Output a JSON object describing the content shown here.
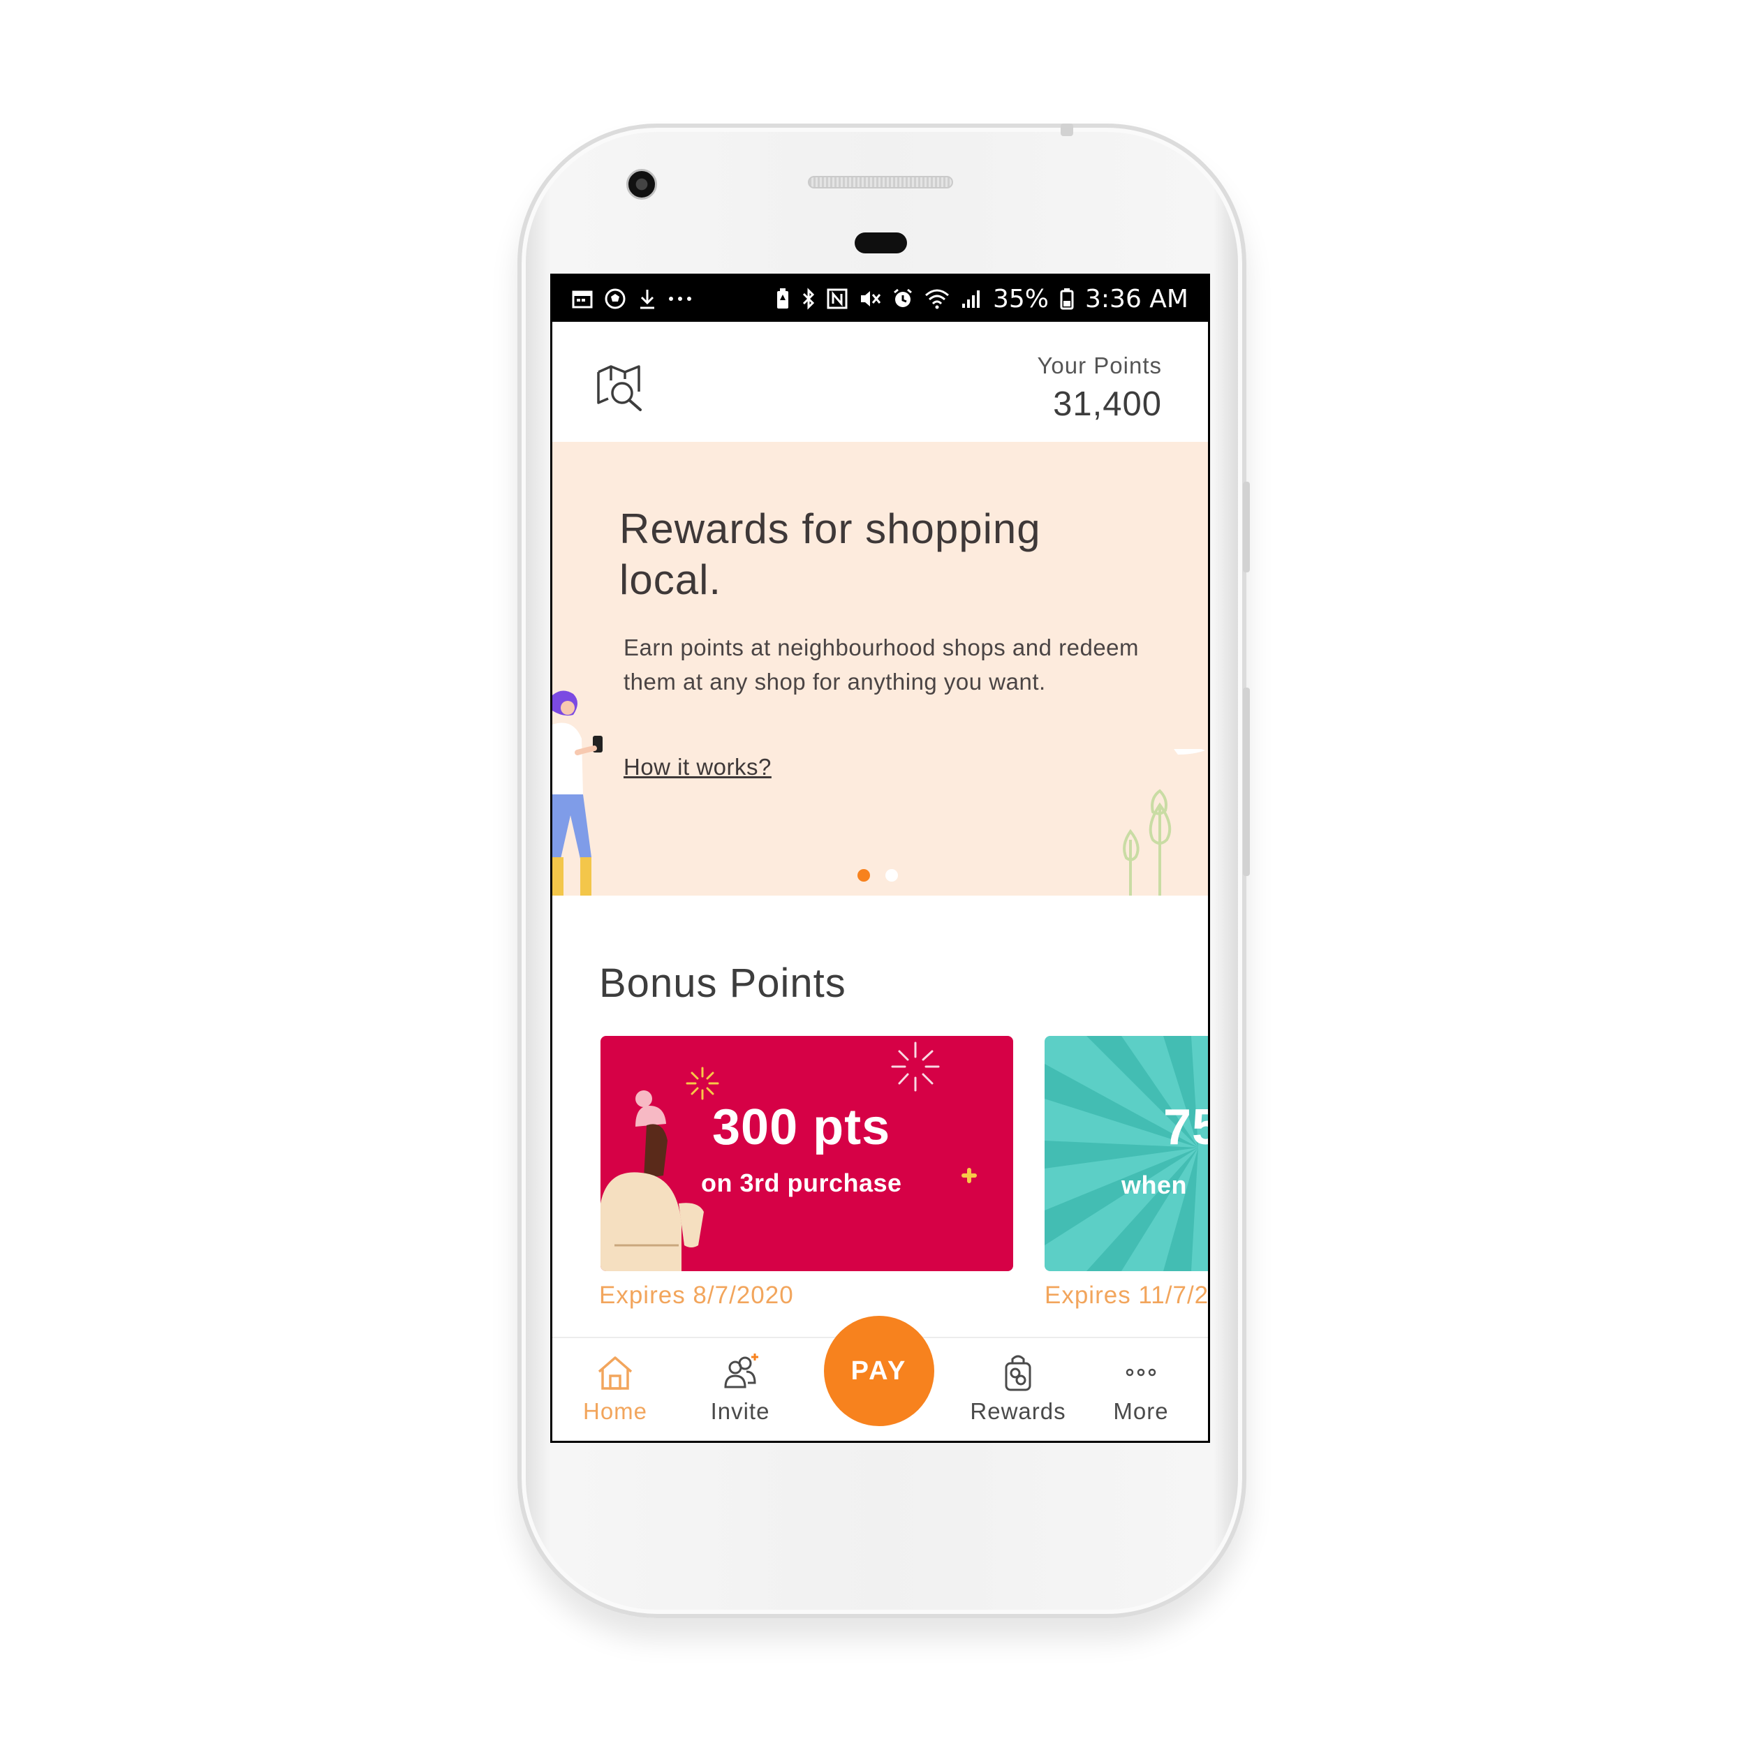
{
  "status_bar": {
    "left_icons": [
      "calendar-icon",
      "soccer-ball-icon",
      "download-icon",
      "more-dots-icon"
    ],
    "right_icons": [
      "battery-saver-icon",
      "bluetooth-icon",
      "nfc-icon",
      "mute-icon",
      "alarm-icon",
      "wifi-icon",
      "signal-icon"
    ],
    "battery": "35%",
    "time": "3:36 AM"
  },
  "header": {
    "map_icon": "map-search-icon",
    "points_label": "Your Points",
    "points_value": "31,400"
  },
  "hero": {
    "title": "Rewards for shopping local.",
    "description": "Earn points at neighbourhood shops and redeem them at any shop for anything you want.",
    "link": "How it works?",
    "slides": 2,
    "active_slide": 1
  },
  "bonus": {
    "title": "Bonus Points",
    "cards": [
      {
        "headline": "300 pts",
        "subline": "on 3rd purchase",
        "expires": "Expires 8/7/2020",
        "color": "#d60146"
      },
      {
        "headline": "75",
        "subline": "when",
        "expires": "Expires 11/7/2",
        "color": "#5ccfc6"
      }
    ]
  },
  "nav": {
    "home": "Home",
    "invite": "Invite",
    "pay": "PAY",
    "rewards": "Rewards",
    "more": "More",
    "active": "home"
  },
  "colors": {
    "accent": "#f7821e",
    "accent_text": "#f2a55c",
    "hero_bg": "#fdebdd"
  }
}
